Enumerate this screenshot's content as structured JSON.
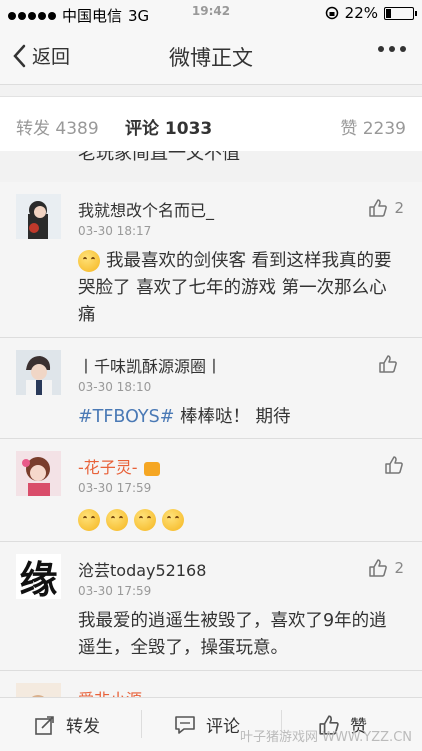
{
  "status": {
    "carrier": "中国电信",
    "network": "3G",
    "time": "19:42",
    "battery": "22%",
    "battery_level": 0.22
  },
  "nav": {
    "back_label": "返回",
    "title": "微博正文"
  },
  "tabs": {
    "repost": "转发 4389",
    "comment": "评论 1033",
    "like": "赞 2239"
  },
  "cut_text": "老玩家简直一文不值",
  "comments": [
    {
      "user": "我就想改个名而已_",
      "time": "03-30 18:17",
      "likes": "2",
      "text": "我最喜欢的剑侠客 看到这样我真的要哭脸了 喜欢了七年的游戏 第一次那么心痛"
    },
    {
      "user": "丨千味凯酥源源圈丨",
      "time": "03-30 18:10",
      "likes": "",
      "hashtag": "#TFBOYS#",
      "text": " 棒棒哒！ 期待"
    },
    {
      "user": "-花子灵-",
      "time": "03-30 17:59",
      "likes": "",
      "text": ""
    },
    {
      "user": "沧芸today52168",
      "time": "03-30 17:59",
      "likes": "2",
      "text": "我最爱的逍遥生被毁了，喜欢了9年的逍遥生，全毁了，操蛋玩意。"
    },
    {
      "user": "爱非小源",
      "time": "",
      "likes": "",
      "text": ""
    }
  ],
  "avatar_glyph": "缘",
  "bottom": {
    "repost": "转发",
    "comment": "评论",
    "like": "赞"
  },
  "watermark": "叶子猪游戏网 WWW.YZZ.CN",
  "colors": {
    "hashtag": "#4a79b5",
    "accent": "#f5a623"
  }
}
